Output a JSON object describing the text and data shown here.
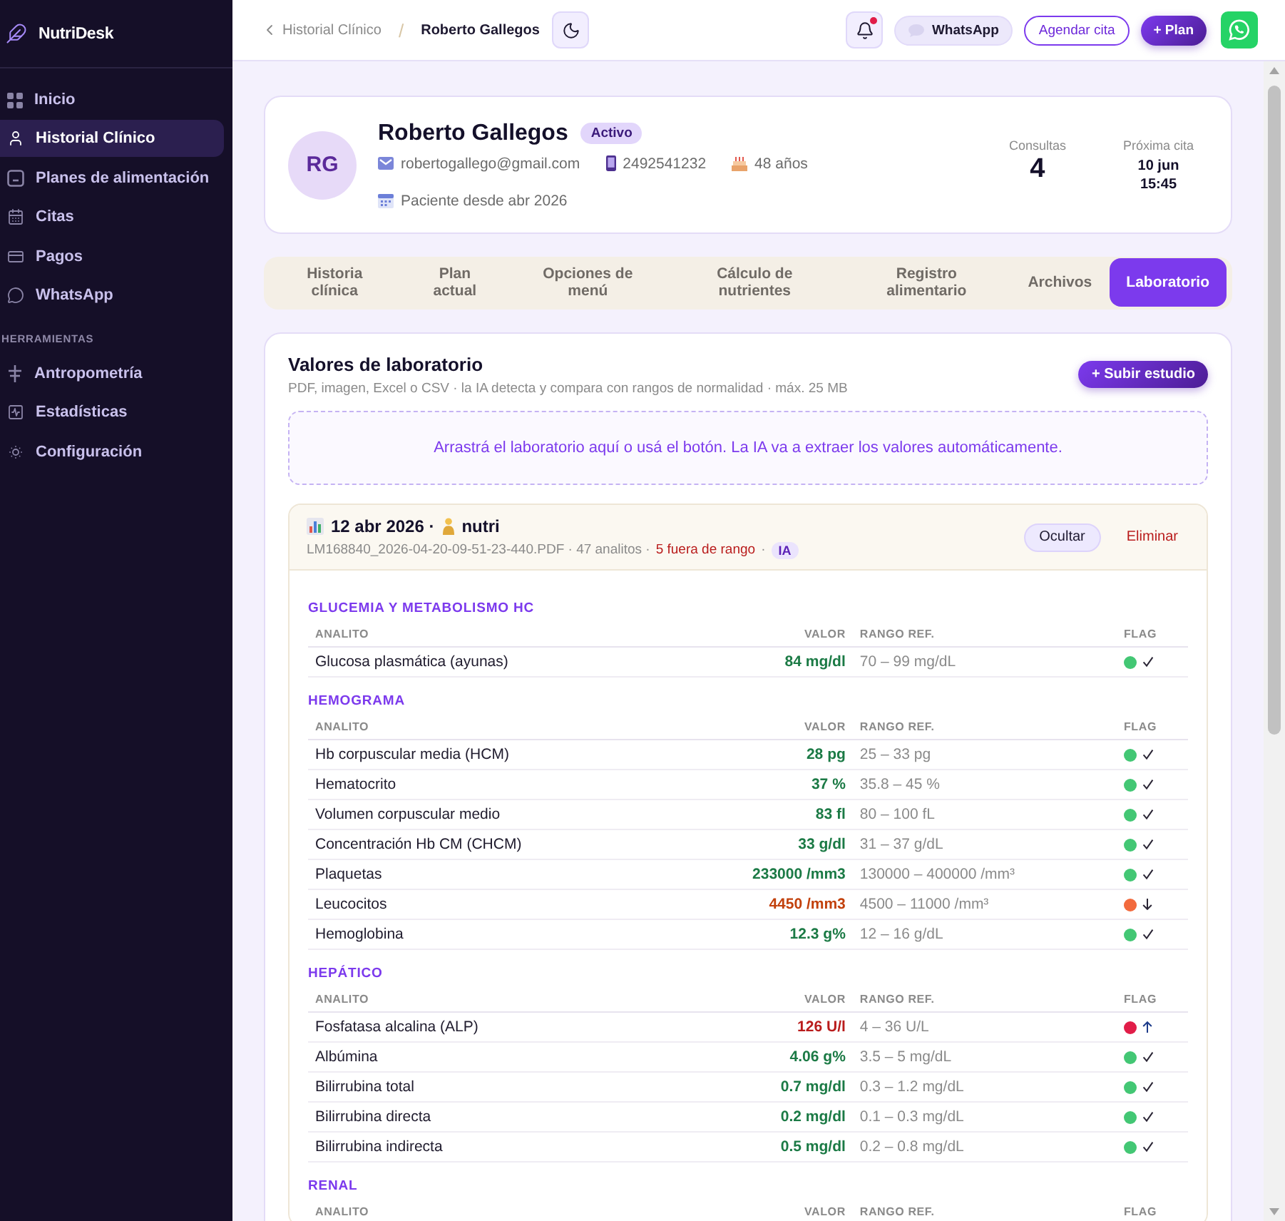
{
  "sidebar": {
    "brand": "NutriDesk",
    "items": [
      {
        "label": "Inicio",
        "selected": false
      },
      {
        "label": "Historial Clínico",
        "selected": true
      },
      {
        "label": "Planes de alimentación",
        "selected": false
      },
      {
        "label": "Citas",
        "selected": false
      },
      {
        "label": "Pagos",
        "selected": false
      },
      {
        "label": "WhatsApp",
        "selected": false
      }
    ],
    "section_label": "HERRAMIENTAS",
    "tools": [
      {
        "label": "Antropometría",
        "selected": false
      },
      {
        "label": "Estadísticas",
        "selected": false
      },
      {
        "label": "Configuración",
        "selected": false
      }
    ]
  },
  "topbar": {
    "breadcrumb": {
      "parent": "Historial Clínico",
      "separator": "/",
      "current": "Roberto Gallegos"
    },
    "notifications": {
      "unread": true
    },
    "buttons": [
      {
        "label": "WhatsApp",
        "kind": "soft"
      },
      {
        "label": "Agendar cita",
        "kind": "outline"
      },
      {
        "label": "+ Plan",
        "kind": "primary"
      }
    ]
  },
  "patient": {
    "initials": "RG",
    "name": "Roberto Gallegos",
    "status": "Activo",
    "email": "robertogallego@gmail.com",
    "phone": "2492541232",
    "age": "48 años",
    "since": "Paciente desde abr 2026",
    "stats": [
      {
        "kind": "count",
        "label": "Consultas",
        "value": "4"
      },
      {
        "kind": "date",
        "label": "Próxima cita",
        "value": "10 jun",
        "time": "15:45"
      }
    ]
  },
  "tabs": [
    {
      "label": "Historia clínica",
      "selected": false
    },
    {
      "label": "Plan actual",
      "selected": false
    },
    {
      "label": "Opciones de menú",
      "selected": false
    },
    {
      "label": "Cálculo de nutrientes",
      "selected": false
    },
    {
      "label": "Registro alimentario",
      "selected": false
    },
    {
      "label": "Archivos",
      "selected": false
    },
    {
      "label": "Laboratorio",
      "selected": true
    }
  ],
  "lab": {
    "title": "Valores de laboratorio",
    "subtitle": "PDF, imagen, Excel o CSV · la IA detecta y compara con rangos de normalidad · máx. 25 MB",
    "upload_button": "+ Subir estudio",
    "dropzone": "Arrastrá el laboratorio aquí o usá el botón. La IA va a extraer los valores automáticamente.",
    "studies": [
      {
        "date": "12 abr 2026 ·",
        "author": "nutri",
        "meta": [
          {
            "text": "LM168840_2026-04-20-09-51-23-440.PDF · 47 analitos ·",
            "alert": false
          },
          {
            "text": "5 fuera de rango",
            "alert": true
          },
          {
            "text": "·",
            "alert": false
          }
        ],
        "badge": "IA",
        "actions": [
          {
            "label": "Ocultar",
            "kind": "soft"
          },
          {
            "label": "Eliminar",
            "kind": "danger"
          }
        ],
        "sections": [
          {
            "title": "GLUCEMIA Y METABOLISMO HC",
            "columns": [
              "ANALITO",
              "VALOR",
              "RANGO REF.",
              "FLAG"
            ],
            "rows": [
              {
                "analyte": "Glucosa plasmática (ayunas)",
                "value": "84 mg/dl",
                "range": "70 – 99 mg/dL",
                "kind": "normal"
              }
            ]
          },
          {
            "title": "HEMOGRAMA",
            "columns": [
              "ANALITO",
              "VALOR",
              "RANGO REF.",
              "FLAG"
            ],
            "rows": [
              {
                "analyte": "Hb corpuscular media (HCM)",
                "value": "28 pg",
                "range": "25 – 33 pg",
                "kind": "normal"
              },
              {
                "analyte": "Hematocrito",
                "value": "37 %",
                "range": "35.8 – 45 %",
                "kind": "normal"
              },
              {
                "analyte": "Volumen corpuscular medio",
                "value": "83 fl",
                "range": "80 – 100 fL",
                "kind": "normal"
              },
              {
                "analyte": "Concentración Hb CM (CHCM)",
                "value": "33 g/dl",
                "range": "31 – 37 g/dL",
                "kind": "normal"
              },
              {
                "analyte": "Plaquetas",
                "value": "233000 /mm3",
                "range": "130000 – 400000 /mm³",
                "kind": "normal"
              },
              {
                "analyte": "Leucocitos",
                "value": "4450 /mm3",
                "range": "4500 – 11000 /mm³",
                "kind": "low"
              },
              {
                "analyte": "Hemoglobina",
                "value": "12.3 g%",
                "range": "12 – 16 g/dL",
                "kind": "normal"
              }
            ]
          },
          {
            "title": "HEPÁTICO",
            "columns": [
              "ANALITO",
              "VALOR",
              "RANGO REF.",
              "FLAG"
            ],
            "rows": [
              {
                "analyte": "Fosfatasa alcalina (ALP)",
                "value": "126 U/l",
                "range": "4 – 36 U/L",
                "kind": "high"
              },
              {
                "analyte": "Albúmina",
                "value": "4.06 g%",
                "range": "3.5 – 5 mg/dL",
                "kind": "normal"
              },
              {
                "analyte": "Bilirrubina total",
                "value": "0.7 mg/dl",
                "range": "0.3 – 1.2 mg/dL",
                "kind": "normal"
              },
              {
                "analyte": "Bilirrubina directa",
                "value": "0.2 mg/dl",
                "range": "0.1 – 0.3 mg/dL",
                "kind": "normal"
              },
              {
                "analyte": "Bilirrubina indirecta",
                "value": "0.5 mg/dl",
                "range": "0.2 – 0.8 mg/dL",
                "kind": "normal"
              }
            ]
          },
          {
            "title": "RENAL",
            "columns": [
              "ANALITO",
              "VALOR",
              "RANGO REF.",
              "FLAG"
            ]
          }
        ]
      }
    ]
  }
}
